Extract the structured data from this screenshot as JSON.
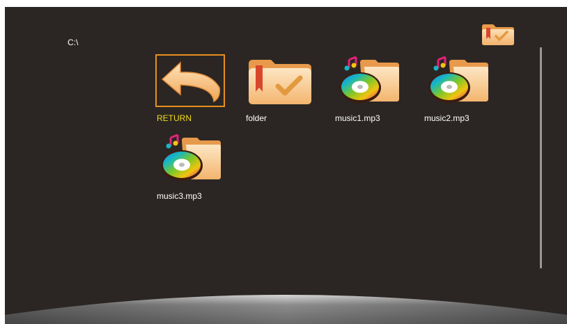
{
  "path": "C:\\",
  "items": [
    {
      "label": "RETURN",
      "type": "return",
      "selected": true
    },
    {
      "label": "folder",
      "type": "folder",
      "selected": false
    },
    {
      "label": "music1.mp3",
      "type": "music",
      "selected": false
    },
    {
      "label": "music2.mp3",
      "type": "music",
      "selected": false
    },
    {
      "label": "music3.mp3",
      "type": "music",
      "selected": false
    }
  ],
  "colors": {
    "background": "#2b2623",
    "selection_border": "#e8901e",
    "selected_label": "#f2dc1b",
    "label": "#ffffff"
  },
  "icons": {
    "return": "return-arrow-icon",
    "folder": "folder-icon",
    "music": "music-file-icon",
    "top": "folder-icon"
  }
}
